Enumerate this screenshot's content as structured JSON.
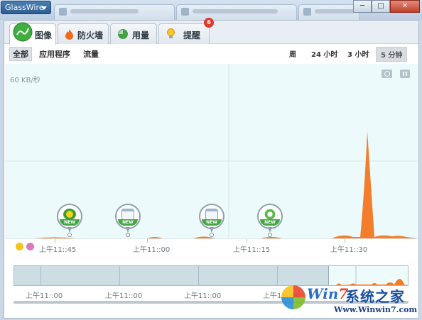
{
  "titlebar": {
    "app_menu_label": "GlassWire",
    "window_buttons": {
      "minimize": "─",
      "maximize": "□",
      "close": "✕"
    }
  },
  "tabs": [
    {
      "label": "图像",
      "icon": "graph-globe-icon",
      "active": true
    },
    {
      "label": "防火墙",
      "icon": "flame-icon",
      "active": false
    },
    {
      "label": "用量",
      "icon": "pie-icon",
      "active": false
    },
    {
      "label": "提醒",
      "icon": "bulb-icon",
      "active": false,
      "badge": "6"
    }
  ],
  "view_filters": [
    {
      "label": "全部",
      "selected": true
    },
    {
      "label": "应用程序",
      "selected": false
    },
    {
      "label": "流量",
      "selected": false
    }
  ],
  "time_ranges": [
    {
      "label": "周",
      "selected": false
    },
    {
      "label": "24 小时",
      "selected": false
    },
    {
      "label": "3 小时",
      "selected": false
    },
    {
      "label": "5 分钟",
      "selected": true
    }
  ],
  "graph": {
    "scale_label": "60 KB/秒",
    "colors": {
      "traffic": "#f47d2c",
      "background": "#edfafb",
      "new_badge": "#44a844"
    },
    "markers": [
      {
        "icon": "360-browser-icon",
        "badge": "NEW"
      },
      {
        "icon": "window-app-icon",
        "badge": "NEW"
      },
      {
        "icon": "window-app-icon",
        "badge": "NEW"
      },
      {
        "icon": "ie-browser-icon",
        "badge": "NEW"
      }
    ]
  },
  "time_axis": {
    "labels": [
      "上午11::45",
      "上午11::00",
      "上午11::15",
      "上午11::30"
    ]
  },
  "overview_axis": {
    "labels": [
      "上午11::00",
      "上午11::00",
      "上午11::00",
      "上午11::00"
    ]
  },
  "watermark": {
    "brand_prefix": "Win",
    "brand_seven": "7",
    "brand_cn": "系统之家",
    "url": "Www.Winwin7.com"
  }
}
